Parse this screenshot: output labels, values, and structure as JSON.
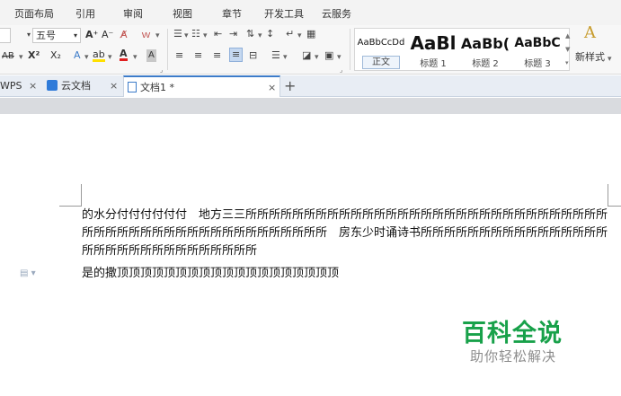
{
  "menu": {
    "tabs": [
      "页面布局",
      "引用",
      "审阅",
      "视图",
      "章节",
      "开发工具",
      "云服务"
    ]
  },
  "ribbon": {
    "font_size_value": "五号",
    "font_grow_label": "A⁺",
    "font_shrink_label": "A⁻",
    "clear_format_label": "A̸",
    "phonetic_label": "ｗ",
    "strikethrough_label": "AB",
    "superscript_label": "X²",
    "subscript_label": "X₂",
    "text_effect_label": "A",
    "highlight_label": "ab",
    "font_color_label": "A",
    "char_shading_label": "A",
    "styles": [
      {
        "preview": "AaBbCcDd",
        "name": "正文"
      },
      {
        "preview": "AaBl",
        "name": "标题 1"
      },
      {
        "preview": "AaBb(",
        "name": "标题 2"
      },
      {
        "preview": "AaBbC",
        "name": "标题 3"
      }
    ],
    "new_style_label": "新样式",
    "new_style_icon_label": "A"
  },
  "doc_tabs": {
    "wps_label": "WPS",
    "cloud_label": "云文档",
    "active_label": "文档1 *",
    "close_glyph": "×",
    "new_tab_glyph": "+"
  },
  "document": {
    "paragraph_1": "的水分付付付付付付　地方三三所所所所所所所所所所所所所所所所所所所所所所所所所所所所所所所所所所所所所所所所所所所所所所所所所所所所　房东少时诵诗书所所所所所所所所所所所所所所所所所所所所所所所所所所所所所所所",
    "paragraph_2": "是的撒顶顶顶顶顶顶顶顶顶顶顶顶顶顶顶顶顶顶顶"
  },
  "watermark": {
    "title": "百科全说",
    "subtitle": "助你轻松解决"
  },
  "colors": {
    "accent": "#3d7cc9",
    "watermark_green": "#18a14a"
  }
}
